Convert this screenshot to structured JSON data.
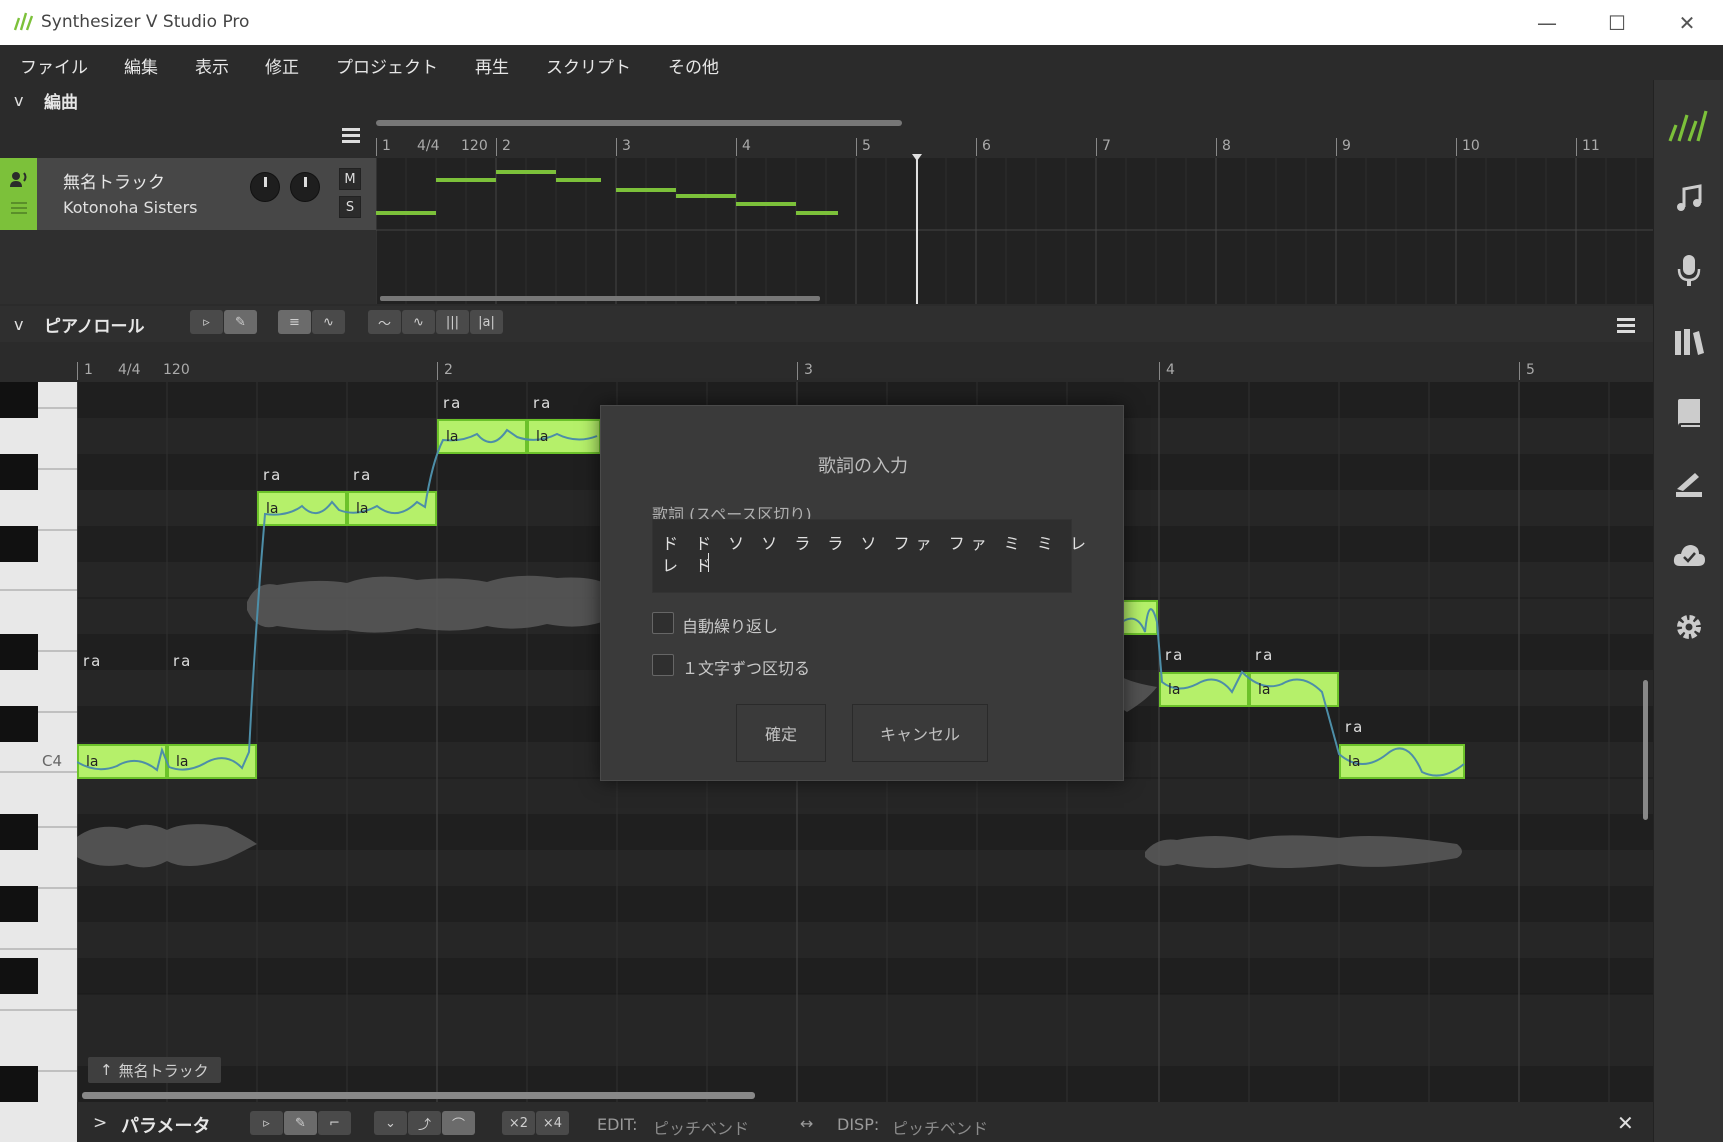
{
  "window": {
    "title": "Synthesizer V Studio Pro"
  },
  "menu": [
    "ファイル",
    "編集",
    "表示",
    "修正",
    "プロジェクト",
    "再生",
    "スクリプト",
    "その他"
  ],
  "arrangement": {
    "title": "編曲",
    "ruler": {
      "bars": [
        "1",
        "2",
        "3",
        "4",
        "5",
        "6",
        "7",
        "8",
        "9",
        "10",
        "11"
      ],
      "time_sig": "4/4",
      "tempo": "120"
    },
    "track": {
      "name": "無名トラック",
      "voice": "Kotonoha Sisters",
      "mute_label": "M",
      "solo_label": "S"
    }
  },
  "pianoroll": {
    "title": "ピアノロール",
    "toolbar_text_tool": "|a|",
    "ruler": {
      "bars": [
        "1",
        "2",
        "3",
        "4",
        "5"
      ],
      "time_sig": "4/4",
      "tempo": "120"
    },
    "c4_label": "C4",
    "track_tag": "無名トラック",
    "notes": [
      {
        "phoneme": "ra",
        "lyric": "la"
      },
      {
        "phoneme": "ra",
        "lyric": "la"
      },
      {
        "phoneme": "ra",
        "lyric": "la"
      },
      {
        "phoneme": "ra",
        "lyric": "la"
      },
      {
        "phoneme": "ra",
        "lyric": "la"
      },
      {
        "phoneme": "ra",
        "lyric": "la"
      },
      {
        "phoneme": "ra",
        "lyric": "la"
      },
      {
        "phoneme": "ra",
        "lyric": "la"
      },
      {
        "phoneme": "ra",
        "lyric": "la"
      }
    ]
  },
  "dialog": {
    "title": "歌詞の入力",
    "field_label": "歌詞 (スペース区切り)",
    "lyrics_line1": "ド ド ソ ソ ラ ラ ソ ファ ファ ミ ミ レ",
    "lyrics_line2": "レ ド",
    "auto_repeat_label": "自動繰り返し",
    "split_chars_label": "１文字ずつ区切る",
    "ok_label": "確定",
    "cancel_label": "キャンセル"
  },
  "param": {
    "title": "パラメータ",
    "x2": "×2",
    "x4": "×4",
    "edit_label": "EDIT:",
    "edit_value": "ピッチベンド",
    "disp_label": "DISP:",
    "disp_value": "ピッチベンド"
  },
  "colors": {
    "accent": "#7cc13a",
    "note_fill": "#b5f06a",
    "note_border": "#6cc22a",
    "pitch_line": "#4d8ea8"
  }
}
